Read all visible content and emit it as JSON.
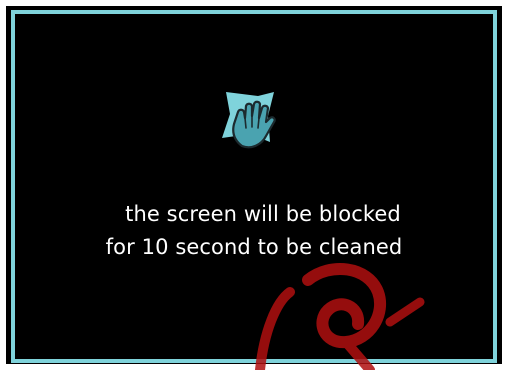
{
  "dialog": {
    "line1": "the screen will be blocked",
    "line2": "for 10 second to be cleaned",
    "icon": "cleaning-cloth-hand-icon"
  },
  "colors": {
    "background": "#000000",
    "frame": "#7fd3db",
    "icon_cloth": "#7fd3db",
    "icon_hand": "#4aa3b0",
    "text": "#ffffff",
    "watermark": "#b01010"
  }
}
